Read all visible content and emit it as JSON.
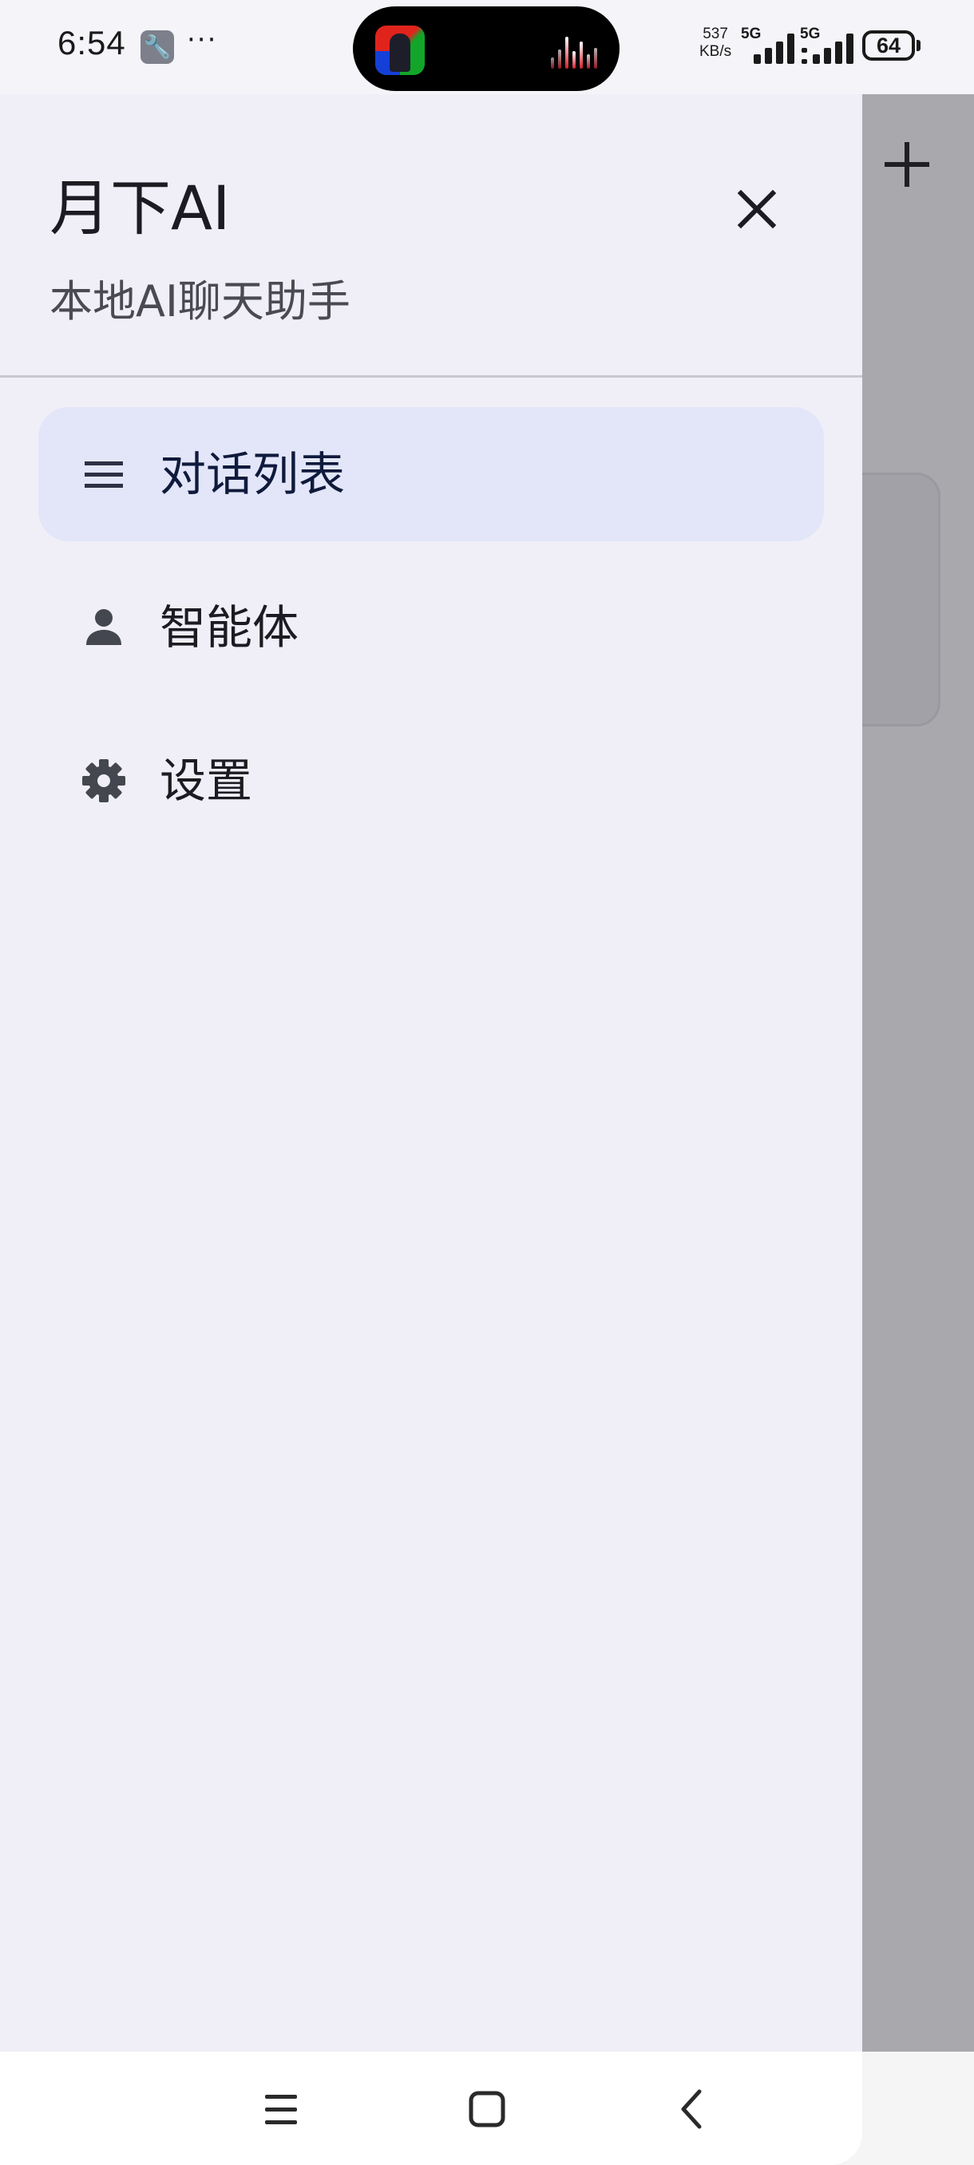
{
  "status_bar": {
    "time": "6:54",
    "more": "···",
    "net_speed_value": "537",
    "net_speed_unit": "KB/s",
    "sim1_label": "5G",
    "sim2_label": "5G",
    "battery": "64"
  },
  "drawer": {
    "title": "月下AI",
    "subtitle": "本地AI聊天助手",
    "items": [
      {
        "label": "对话列表",
        "icon": "menu-icon",
        "active": true
      },
      {
        "label": "智能体",
        "icon": "person-icon",
        "active": false
      },
      {
        "label": "设置",
        "icon": "gear-icon",
        "active": false
      }
    ]
  },
  "background_app": {
    "add_icon": "plus-icon"
  },
  "system_nav": {
    "buttons": [
      "recents-icon",
      "home-icon",
      "back-icon"
    ]
  },
  "colors": {
    "drawer_bg": "#f0eff8",
    "active_item_bg": "#e2e6f8",
    "scrim": "#a9a8ad"
  }
}
